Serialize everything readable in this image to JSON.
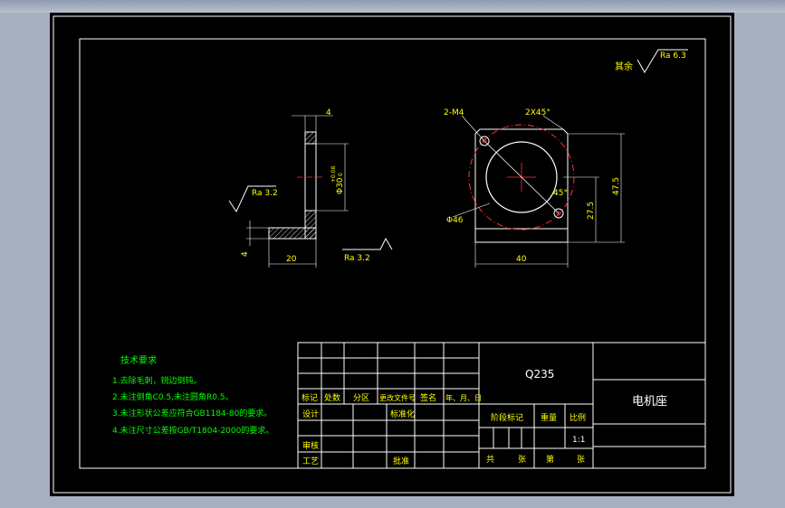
{
  "surface_roughness_rest": {
    "label": "其余",
    "value": "Ra 6.3"
  },
  "side_view": {
    "dim_thickness": "4",
    "dim_bore": "Φ30",
    "dim_bore_tol_upper": "+0.08",
    "dim_bore_tol_lower": "0",
    "roughness_left": "Ra 3.2",
    "roughness_bottom": "Ra 3.2",
    "dim_base_thickness": "4",
    "dim_base_length": "20"
  },
  "front_view": {
    "holes_label": "2-M4",
    "chamfer_label": "2X45°",
    "angle_label": "45°",
    "pitch_circle_label": "Φ46",
    "dim_center_height": "27.5",
    "dim_total_height": "47.5",
    "dim_width": "40"
  },
  "tech_requirements": {
    "title": "技术要求",
    "items": [
      "1.去除毛刺，锐边倒钝。",
      "2.未注倒角C0.5,未注圆角R0.5。",
      "3.未注形状公差应符合GB1184-80的要求。",
      "4.未注尺寸公差按GB/T1804-2000的要求。"
    ]
  },
  "title_block": {
    "material": "Q235",
    "part_name": "电机座",
    "header_row": [
      "标记",
      "处数",
      "分区",
      "更改文件号",
      "签名",
      "年、月、日"
    ],
    "design_label": "设计",
    "standardize_label": "标准化",
    "review_label": "审核",
    "process_label": "工艺",
    "approve_label": "批准",
    "stage_mark_label": "阶段标记",
    "weight_label": "重量",
    "scale_label": "比例",
    "scale_value": "1:1",
    "sheets_total_label": "共",
    "sheets_label_1": "张",
    "sheet_no_label": "第",
    "sheets_label_2": "张"
  }
}
